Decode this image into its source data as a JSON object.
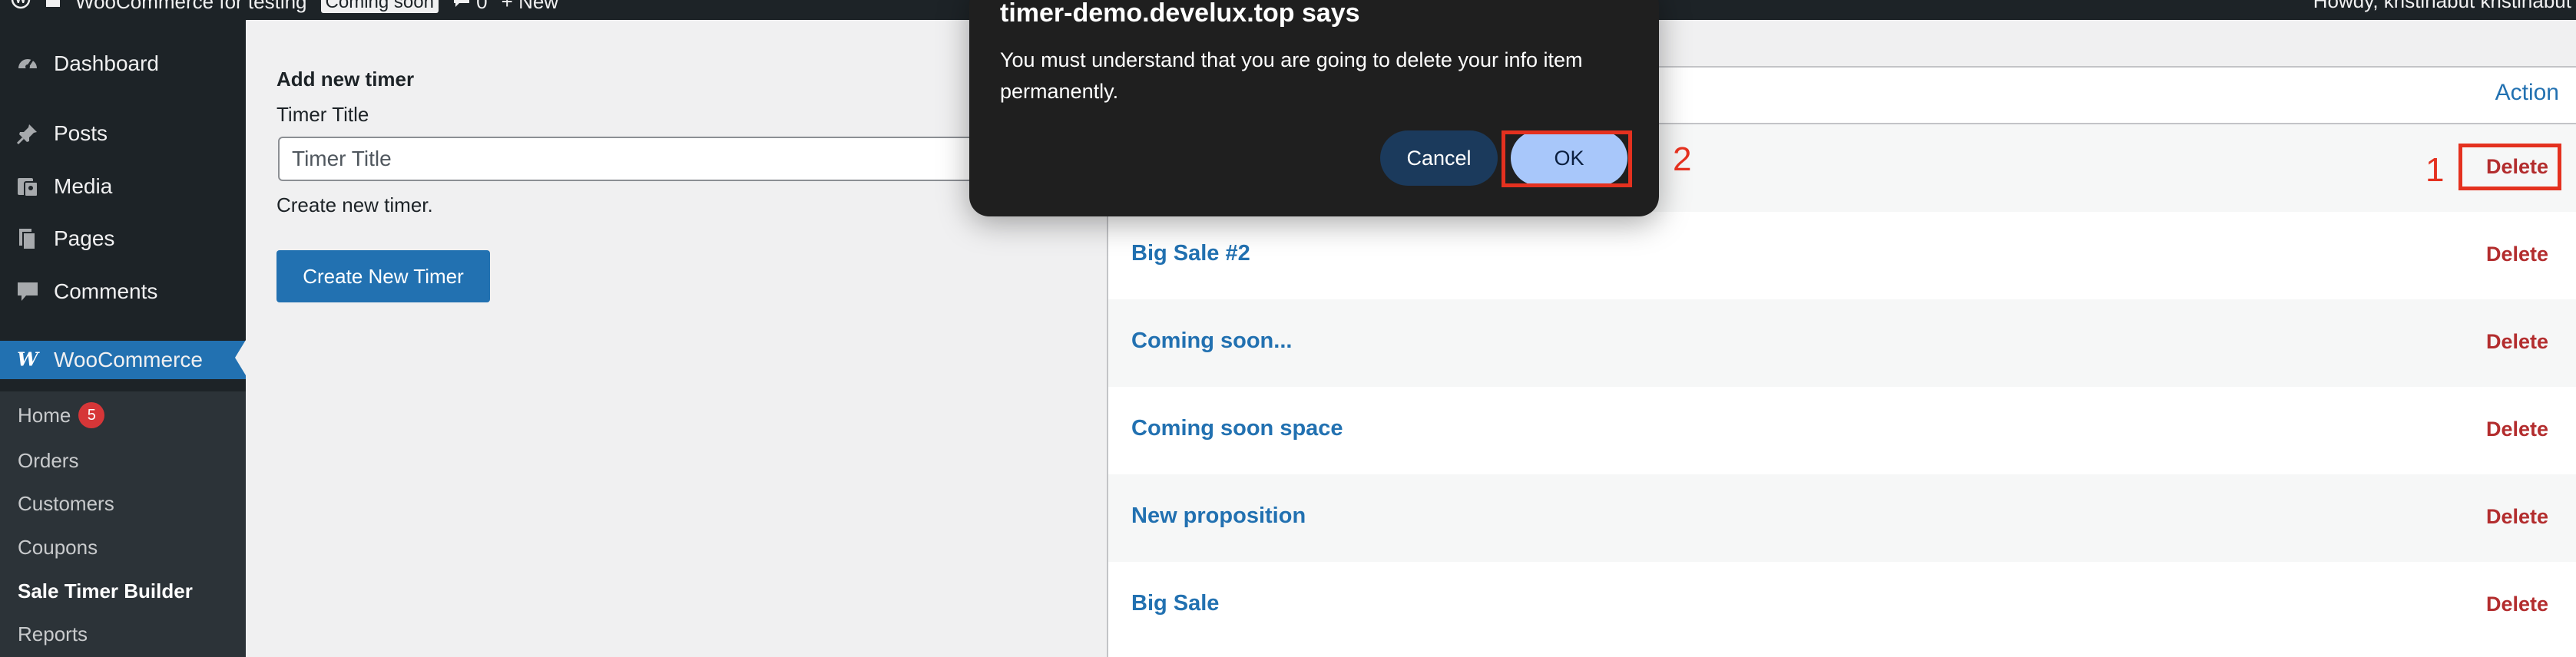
{
  "admin_bar": {
    "site_name": "WooCommerce for testing",
    "status_badge": "Coming soon",
    "comments_count": "0",
    "new_label": "New",
    "greeting": "Howdy, kristinabut kristinabut"
  },
  "sidebar": {
    "items": [
      {
        "label": "Dashboard",
        "icon": "dashboard-icon"
      },
      {
        "label": "Posts",
        "icon": "pin-icon"
      },
      {
        "label": "Media",
        "icon": "media-icon"
      },
      {
        "label": "Pages",
        "icon": "pages-icon"
      },
      {
        "label": "Comments",
        "icon": "comment-icon"
      },
      {
        "label": "WooCommerce",
        "icon": "woocommerce-icon"
      }
    ],
    "submenu": [
      {
        "label": "Home",
        "badge": "5"
      },
      {
        "label": "Orders"
      },
      {
        "label": "Customers"
      },
      {
        "label": "Coupons"
      },
      {
        "label": "Sale Timer Builder"
      },
      {
        "label": "Reports"
      }
    ]
  },
  "form": {
    "heading": "Add new timer",
    "field_label": "Timer Title",
    "input_placeholder": "Timer Title",
    "input_value": "",
    "help_text": "Create new timer.",
    "create_button": "Create New Timer"
  },
  "table": {
    "action_header": "Action",
    "rows": [
      {
        "title": "",
        "action": "Delete"
      },
      {
        "title": "Big Sale #2",
        "action": "Delete"
      },
      {
        "title": "Coming soon...",
        "action": "Delete"
      },
      {
        "title": "Coming soon space",
        "action": "Delete"
      },
      {
        "title": "New proposition",
        "action": "Delete"
      },
      {
        "title": "Big Sale",
        "action": "Delete"
      }
    ]
  },
  "dialog": {
    "title": "timer-demo.develux.top says",
    "message": "You must understand that you are going to delete your info item permanently.",
    "cancel_label": "Cancel",
    "ok_label": "OK"
  },
  "annotations": {
    "step_1": "1",
    "step_2": "2",
    "color": "#e4311f"
  },
  "colors": {
    "accent": "#2271b1",
    "delete": "#b32d2e",
    "sidebar_bg": "#1d2327"
  }
}
